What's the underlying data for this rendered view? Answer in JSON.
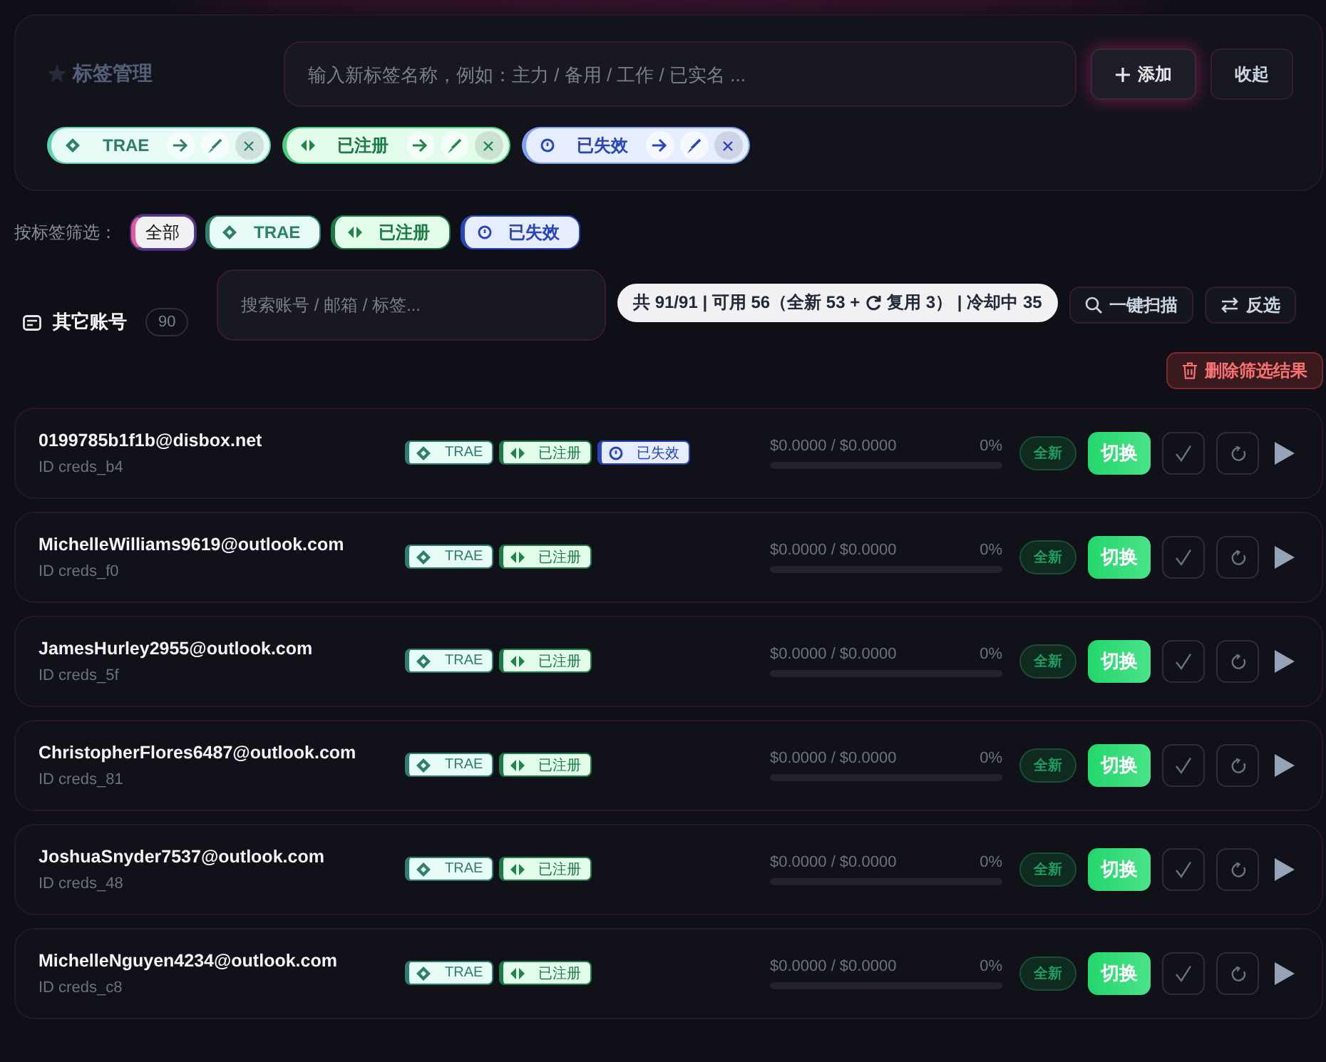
{
  "tag_manager": {
    "title": "标签管理",
    "input": {
      "placeholder": "输入新标签名称，例如：主力 / 备用 / 工作 / 已实名 ..."
    },
    "add_button": "添加",
    "collapse_button": "收起",
    "tags": [
      {
        "label": "TRAE",
        "kind": "trae"
      },
      {
        "label": "已注册",
        "kind": "registered"
      },
      {
        "label": "已失效",
        "kind": "expired"
      }
    ]
  },
  "filter": {
    "label": "按标签筛选：",
    "chips": [
      {
        "label": "全部",
        "kind": "all",
        "selected": true
      },
      {
        "label": "TRAE",
        "kind": "trae",
        "selected": false
      },
      {
        "label": "已注册",
        "kind": "registered",
        "selected": false
      },
      {
        "label": "已失效",
        "kind": "expired",
        "selected": false
      }
    ]
  },
  "toolbar": {
    "section_title": "其它账号",
    "count": "90",
    "search": {
      "placeholder": "搜索账号 / 邮箱 / 标签..."
    },
    "stats_before": "共 91/91 | 可用 56（全新 53 +",
    "stats_after": "复用 3） | 冷却中 35",
    "scan_button": "一键扫描",
    "invert_button": "反选",
    "delete_button": "删除筛选结果"
  },
  "accounts": [
    {
      "email": "0199785b1f1b@disbox.net",
      "id": "ID creds_b4",
      "tags": [
        {
          "label": "TRAE",
          "kind": "trae"
        },
        {
          "label": "已注册",
          "kind": "registered"
        },
        {
          "label": "已失效",
          "kind": "expired"
        }
      ],
      "usage": "$0.0000 / $0.0000",
      "percent": "0%",
      "level": 0,
      "badge": "全新",
      "switch": "切换"
    },
    {
      "email": "MichelleWilliams9619@outlook.com",
      "id": "ID creds_f0",
      "tags": [
        {
          "label": "TRAE",
          "kind": "trae"
        },
        {
          "label": "已注册",
          "kind": "registered"
        }
      ],
      "usage": "$0.0000 / $0.0000",
      "percent": "0%",
      "level": 0,
      "badge": "全新",
      "switch": "切换"
    },
    {
      "email": "JamesHurley2955@outlook.com",
      "id": "ID creds_5f",
      "tags": [
        {
          "label": "TRAE",
          "kind": "trae"
        },
        {
          "label": "已注册",
          "kind": "registered"
        }
      ],
      "usage": "$0.0000 / $0.0000",
      "percent": "0%",
      "level": 0,
      "badge": "全新",
      "switch": "切换"
    },
    {
      "email": "ChristopherFlores6487@outlook.com",
      "id": "ID creds_81",
      "tags": [
        {
          "label": "TRAE",
          "kind": "trae"
        },
        {
          "label": "已注册",
          "kind": "registered"
        }
      ],
      "usage": "$0.0000 / $0.0000",
      "percent": "0%",
      "level": 0,
      "badge": "全新",
      "switch": "切换"
    },
    {
      "email": "JoshuaSnyder7537@outlook.com",
      "id": "ID creds_48",
      "tags": [
        {
          "label": "TRAE",
          "kind": "trae"
        },
        {
          "label": "已注册",
          "kind": "registered"
        }
      ],
      "usage": "$0.0000 / $0.0000",
      "percent": "0%",
      "level": 0,
      "badge": "全新",
      "switch": "切换"
    },
    {
      "email": "MichelleNguyen4234@outlook.com",
      "id": "ID creds_c8",
      "tags": [
        {
          "label": "TRAE",
          "kind": "trae"
        },
        {
          "label": "已注册",
          "kind": "registered"
        }
      ],
      "usage": "$0.0000 / $0.0000",
      "percent": "0%",
      "level": 0,
      "badge": "全新",
      "switch": "切换"
    }
  ]
}
